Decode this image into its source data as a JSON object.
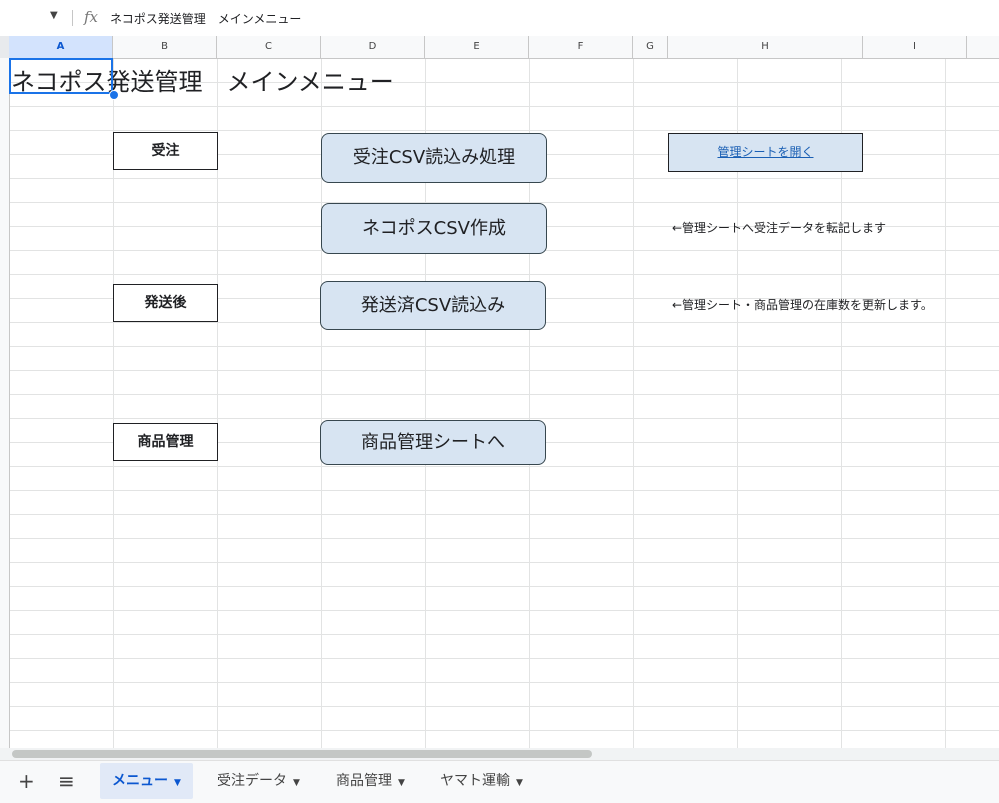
{
  "formula_bar": {
    "dropdown_icon": "caret-down-icon",
    "fx_label": "fx",
    "content": "ネコポス発送管理　メインメニュー"
  },
  "columns": [
    "A",
    "B",
    "C",
    "D",
    "E",
    "F",
    "G",
    "H",
    "I"
  ],
  "selected_column": "A",
  "sheet": {
    "title": "ネコポス発送管理　メインメニュー",
    "labels": {
      "order": "受注",
      "after_ship": "発送後",
      "product": "商品管理"
    },
    "buttons": {
      "order_csv": "受注CSV読込み処理",
      "nekopos_csv": "ネコポスCSV作成",
      "shipped_csv": "発送済CSV読込み",
      "product_sheet": "商品管理シートへ"
    },
    "link": "管理シートを開く",
    "notes": {
      "nekopos": "←管理シートへ受注データを転記します",
      "shipped": "←管理シート・商品管理の在庫数を更新します。"
    }
  },
  "tabbar": {
    "add_icon": "plus-icon",
    "menu_icon": "hamburger-icon",
    "tabs": [
      {
        "label": "メニュー",
        "active": true
      },
      {
        "label": "受注データ",
        "active": false
      },
      {
        "label": "商品管理",
        "active": false
      },
      {
        "label": "ヤマト運輸",
        "active": false
      }
    ]
  },
  "colors": {
    "button_fill": "#d7e4f2",
    "selection": "#1a73e8",
    "active_tab": "#0b57d0"
  }
}
